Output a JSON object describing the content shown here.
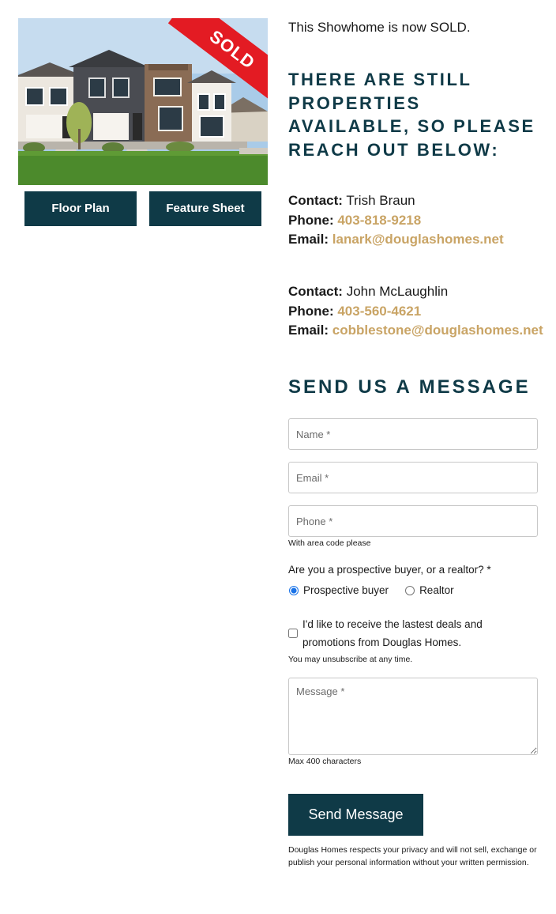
{
  "photo": {
    "alt": "Showhome exterior photo",
    "badge": "SOLD"
  },
  "buttons": {
    "floor_plan": "Floor Plan",
    "feature_sheet": "Feature Sheet"
  },
  "intro": "This Showhome is now SOLD.",
  "headline": "THERE ARE STILL PROPERTIES AVAILABLE, SO PLEASE REACH OUT BELOW:",
  "contacts": [
    {
      "contact_label": "Contact:",
      "name": "Trish Braun",
      "phone_label": "Phone:",
      "phone": "403-818-9218",
      "email_label": "Email:",
      "email": "lanark@douglashomes.net"
    },
    {
      "contact_label": "Contact:",
      "name": "John McLaughlin",
      "phone_label": "Phone:",
      "phone": "403-560-4621",
      "email_label": "Email:",
      "email": "cobblestone@douglashomes.net"
    }
  ],
  "form": {
    "title": "SEND US A MESSAGE",
    "name_placeholder": "Name *",
    "email_placeholder": "Email *",
    "phone_placeholder": "Phone *",
    "phone_help": "With area code please",
    "buyer_question": "Are you a prospective buyer, or a realtor? *",
    "options": [
      "Prospective buyer",
      "Realtor"
    ],
    "selected_option": "Prospective buyer",
    "opt_in_label": "I'd like to receive the lastest deals and promotions from Douglas Homes.",
    "opt_in_checked": false,
    "unsubscribe_note": "You may unsubscribe at any time.",
    "message_placeholder": "Message *",
    "message_help": "Max 400 characters",
    "submit_label": "Send Message",
    "privacy_note": "Douglas Homes respects your privacy and will not sell, exchange or publish your personal information without your written permission."
  },
  "colors": {
    "primary": "#0f3a47",
    "link": "#c9a465",
    "badge": "#e31b23"
  }
}
